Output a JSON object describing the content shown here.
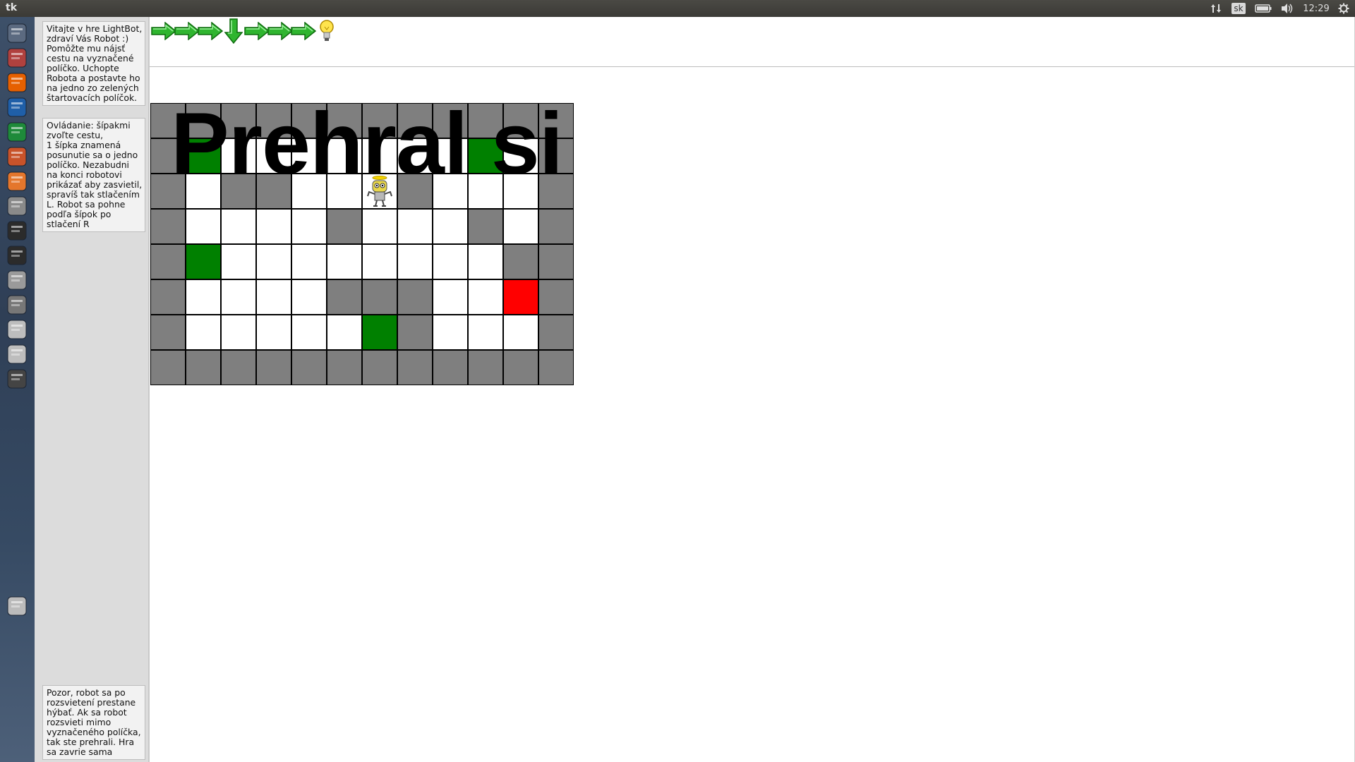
{
  "window": {
    "title": "tk"
  },
  "tray": {
    "network_icon": "up-down-arrows-icon",
    "language": "sk",
    "battery_icon": "battery-icon",
    "volume_icon": "volume-icon",
    "time": "12:29",
    "settings_icon": "gear-icon"
  },
  "launcher": {
    "items": [
      {
        "name": "ubuntu-dash-icon",
        "color": "#5b6a80"
      },
      {
        "name": "file-manager-icon",
        "color": "#b0413e"
      },
      {
        "name": "firefox-icon",
        "color": "#e66000"
      },
      {
        "name": "writer-icon",
        "color": "#1f5fa8"
      },
      {
        "name": "calc-icon",
        "color": "#1e8a3a"
      },
      {
        "name": "impress-icon",
        "color": "#c8532a"
      },
      {
        "name": "software-center-icon",
        "color": "#e4762c"
      },
      {
        "name": "system-settings-icon",
        "color": "#8a8a8a"
      },
      {
        "name": "terminal-icon",
        "color": "#2b2b2b"
      },
      {
        "name": "system-monitor-icon",
        "color": "#2b2b2b"
      },
      {
        "name": "help-icon",
        "color": "#9a9a9a"
      },
      {
        "name": "tk-window-icon",
        "color": "#777777"
      },
      {
        "name": "drive-icon",
        "color": "#bdbdbd"
      },
      {
        "name": "drive-icon",
        "color": "#bdbdbd"
      },
      {
        "name": "phone-icon",
        "color": "#444444"
      },
      {
        "name": "trash-icon",
        "color": "#bbbbbb"
      }
    ]
  },
  "info": {
    "welcome": "Vitajte v hre LightBot, zdraví Vás Robot :) Pomôžte mu nájsť cestu na vyznačené políčko. Uchopte Robota a postavte ho na jedno zo zelených štartovacích políčok.",
    "controls": "Ovládanie: šípakmi zvoľte cestu,\n 1 šípka znamená posunutie sa o jedno políčko. Nezabudni na konci robotovi prikázať aby zasvietil, spravíš tak stlačením L. Robot sa pohne podľa šípok po stlačení R",
    "warning": "Pozor, robot sa po rozsvietení prestane hýbať. Ak sa robot rozsvieti mimo vyznačeného políčka, tak ste prehrali. Hra sa zavrie sama"
  },
  "program": {
    "commands": [
      "right",
      "right",
      "right",
      "down",
      "right",
      "right",
      "right",
      "light"
    ]
  },
  "board": {
    "rows": 8,
    "cols": 12,
    "legend": {
      "G": "#7f7f7f",
      "W": "#ffffff",
      "S": "#008000",
      "T": "#ff0000"
    },
    "cells": [
      "GGGGGGGGGGGG",
      "GSWWWWWWWSWG",
      "GWGGWWWGWWWG",
      "GWWWWGWWWGWG",
      "GSWWWWWWWWGG",
      "GWWWWGGGWWTG",
      "GWWWWWSGWWWG",
      "GGGGGGGGGGGG"
    ],
    "robot": {
      "row": 2,
      "col": 6
    }
  },
  "overlay_text": "Prehral si"
}
